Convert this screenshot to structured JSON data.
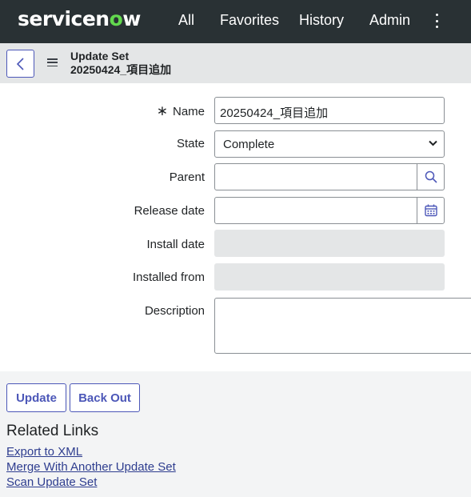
{
  "nav": {
    "logo_before": "servicen",
    "logo_o": "o",
    "logo_after": "w",
    "items": [
      "All",
      "Favorites",
      "History",
      "Admin"
    ]
  },
  "header": {
    "type_label": "Update Set",
    "record_name": "20250424_項目追加"
  },
  "form": {
    "required_marker": "∗",
    "name_label": "Name",
    "name_value": "20250424_項目追加",
    "state_label": "State",
    "state_value": "Complete",
    "parent_label": "Parent",
    "parent_value": "",
    "release_date_label": "Release date",
    "release_date_value": "",
    "install_date_label": "Install date",
    "installed_from_label": "Installed from",
    "description_label": "Description",
    "description_value": ""
  },
  "actions": {
    "update_label": "Update",
    "back_out_label": "Back Out"
  },
  "related_links": {
    "title": "Related Links",
    "links": [
      "Export to XML",
      "Merge With Another Update Set",
      "Scan Update Set"
    ]
  },
  "icons": {
    "back": "chevron-left-icon",
    "menu": "hamburger-menu-icon",
    "more": "kebab-vertical-icon",
    "search": "search-icon",
    "calendar": "calendar-icon",
    "dropdown": "chevron-down-icon"
  },
  "colors": {
    "nav_bg": "#293134",
    "logo_accent": "#62d84e",
    "primary": "#4c57b8",
    "link": "#2e3d8f",
    "readonly_bg": "#e4e6e7"
  }
}
